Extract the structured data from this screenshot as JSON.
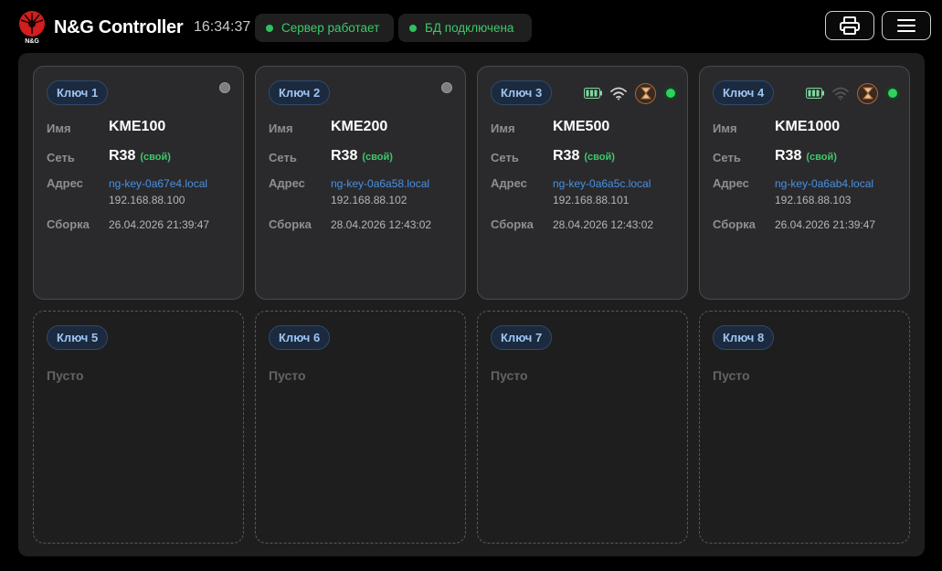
{
  "header": {
    "logo_text": "N&G",
    "title": "N&G Controller",
    "clock": "16:34:37",
    "server_status": "Сервер работает",
    "db_status": "БД подключена",
    "print_icon": "printer-icon",
    "menu_icon": "hamburger-menu-icon",
    "status_color": "#2fc15f"
  },
  "labels": {
    "name": "Имя",
    "network": "Сеть",
    "address": "Адрес",
    "build": "Сборка",
    "empty": "Пусто",
    "own": "(свой)"
  },
  "keys": [
    {
      "label": "Ключ 1",
      "name": "KME100",
      "network": "R38",
      "host": "ng-key-0a67e4.local",
      "ip": "192.168.88.100",
      "build": "26.04.2026 21:39:47",
      "online": false
    },
    {
      "label": "Ключ 2",
      "name": "KME200",
      "network": "R38",
      "host": "ng-key-0a6a58.local",
      "ip": "192.168.88.102",
      "build": "28.04.2026 12:43:02",
      "online": false
    },
    {
      "label": "Ключ 3",
      "name": "KME500",
      "network": "R38",
      "host": "ng-key-0a6a5c.local",
      "ip": "192.168.88.101",
      "build": "28.04.2026 12:43:02",
      "online": true,
      "wifi": "strong"
    },
    {
      "label": "Ключ 4",
      "name": "KME1000",
      "network": "R38",
      "host": "ng-key-0a6ab4.local",
      "ip": "192.168.88.103",
      "build": "26.04.2026 21:39:47",
      "online": true,
      "wifi": "weak"
    },
    {
      "label": "Ключ 5"
    },
    {
      "label": "Ключ 6"
    },
    {
      "label": "Ключ 7"
    },
    {
      "label": "Ключ 8"
    }
  ]
}
